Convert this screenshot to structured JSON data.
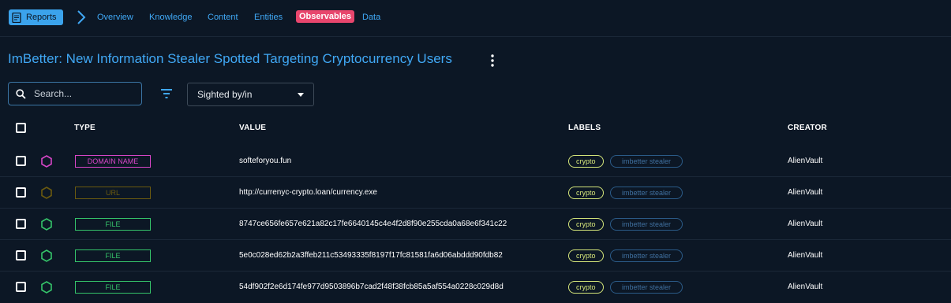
{
  "nav": {
    "reports_label": "Reports",
    "tabs": [
      {
        "label": "Overview"
      },
      {
        "label": "Knowledge"
      },
      {
        "label": "Content"
      },
      {
        "label": "Entities"
      },
      {
        "label": "Observables",
        "active": true
      },
      {
        "label": "Data"
      }
    ]
  },
  "page": {
    "title": "ImBetter: New Information Stealer Spotted Targeting Cryptocurrency Users"
  },
  "toolbar": {
    "search_placeholder": "Search...",
    "filter_icon": "filter-icon",
    "select_value": "Sighted by/in"
  },
  "table": {
    "headers": {
      "type": "TYPE",
      "value": "VALUE",
      "labels": "LABELS",
      "creator": "CREATOR"
    },
    "rows": [
      {
        "type": "DOMAIN NAME",
        "type_color": "#d846c8",
        "value": "softeforyou.fun",
        "labels": [
          "crypto",
          "imbetter stealer"
        ],
        "creator": "AlienVault"
      },
      {
        "type": "URL",
        "type_color": "#6b5a0f",
        "value": "http://currenyc-crypto.loan/currency.exe",
        "labels": [
          "crypto",
          "imbetter stealer"
        ],
        "creator": "AlienVault"
      },
      {
        "type": "FILE",
        "type_color": "#35c46a",
        "value": "8747ce656fe657e621a82c17fe6640145c4e4f2d8f90e255cda0a68e6f341c22",
        "labels": [
          "crypto",
          "imbetter stealer"
        ],
        "creator": "AlienVault"
      },
      {
        "type": "FILE",
        "type_color": "#35c46a",
        "value": "5e0c028ed62b2a3ffeb211c53493335f8197f17fc81581fa6d06abddd90fdb82",
        "labels": [
          "crypto",
          "imbetter stealer"
        ],
        "creator": "AlienVault"
      },
      {
        "type": "FILE",
        "type_color": "#35c46a",
        "value": "54df902f2e6d174fe977d9503896b7cad2f48f38fcb85a5af554a0228c029d8d",
        "labels": [
          "crypto",
          "imbetter stealer"
        ],
        "creator": "AlienVault"
      }
    ]
  },
  "colors": {
    "accent": "#40a8f5",
    "active_tab": "#e8466d",
    "crypto_label": "#d5e67a",
    "stealer_label": "#2b5b88"
  }
}
